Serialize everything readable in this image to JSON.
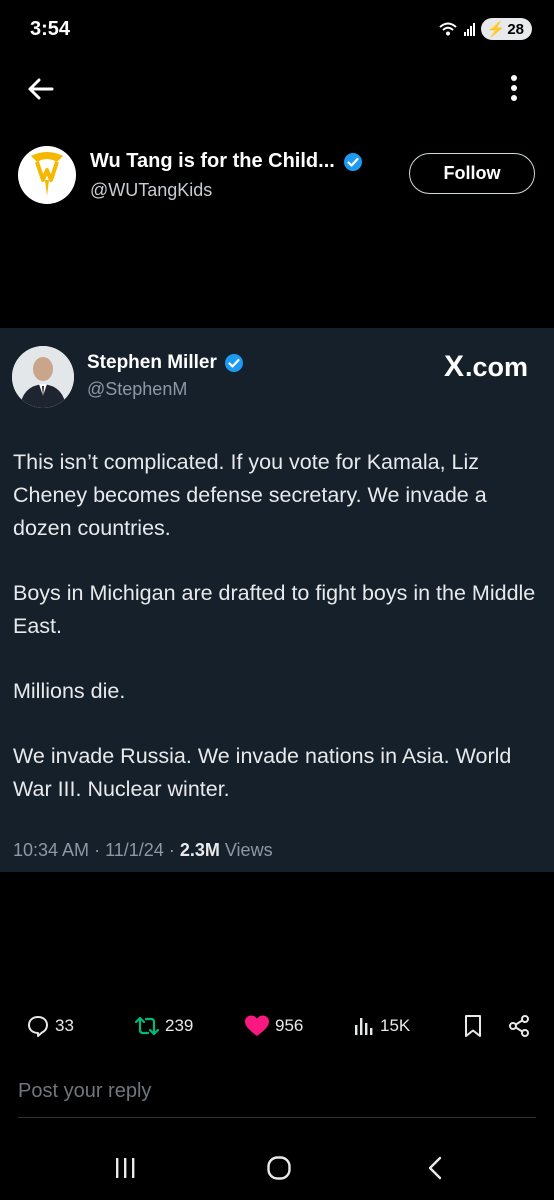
{
  "status_bar": {
    "time": "3:54",
    "wifi_label": "6",
    "battery": "28"
  },
  "header": {
    "back_icon": "arrow-left-icon",
    "more_icon": "vertical-dots-icon"
  },
  "profile": {
    "name": "Wu Tang is for the Child...",
    "handle": "@WUTangKids",
    "follow_label": "Follow",
    "verified_color": "#1d9bf0"
  },
  "card": {
    "author_name": "Stephen Miller",
    "author_handle": "@StephenM",
    "brand": "X.com",
    "paragraphs": [
      "This isn’t complicated. If you vote for Kamala, Liz Cheney becomes defense secretary. We invade a dozen countries.",
      "Boys in Michigan are drafted to fight boys in the Middle East.",
      "Millions die.",
      "We invade Russia. We invade nations in Asia. World War III. Nuclear winter."
    ],
    "time": "10:34 AM",
    "date": "11/1/24",
    "views_count": "2.3M",
    "views_label": "Views"
  },
  "actions": {
    "replies": "33",
    "reposts": "239",
    "likes": "956",
    "views": "15K",
    "repost_color": "#00ba7c",
    "like_color": "#f91880"
  },
  "reply": {
    "placeholder": "Post your reply"
  },
  "navbar": {
    "recents_icon": "recents-icon",
    "home_icon": "home-circle-icon",
    "back_icon": "chevron-left-icon"
  }
}
